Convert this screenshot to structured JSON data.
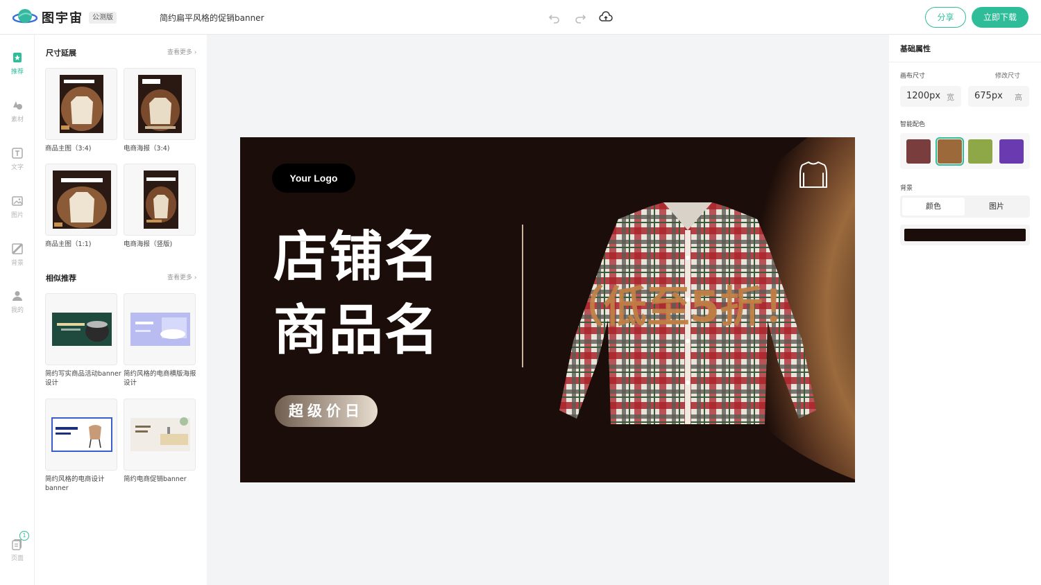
{
  "app": {
    "brand": "图宇宙",
    "badge": "公测版",
    "doc_title": "简约扁平风格的促销banner"
  },
  "toolbar": {
    "share_label": "分享",
    "download_label": "立即下载"
  },
  "rail": {
    "items": [
      {
        "label": "推荐",
        "icon": "star-icon"
      },
      {
        "label": "素材",
        "icon": "shapes-icon"
      },
      {
        "label": "文字",
        "icon": "text-icon"
      },
      {
        "label": "图片",
        "icon": "image-icon"
      },
      {
        "label": "背景",
        "icon": "background-icon"
      },
      {
        "label": "我的",
        "icon": "user-icon"
      }
    ],
    "pages": {
      "label": "页面",
      "count": "1"
    }
  },
  "panel": {
    "size_section": {
      "title": "尺寸延展",
      "more": "查看更多",
      "templates": [
        {
          "caption": "商品主图（3:4)"
        },
        {
          "caption": "电商海报（3:4)"
        },
        {
          "caption": "商品主图（1:1)"
        },
        {
          "caption": "电商海报（竖版)"
        }
      ]
    },
    "similar_section": {
      "title": "相似推荐",
      "more": "查看更多",
      "templates": [
        {
          "caption": "简约写实商品活动banner设计"
        },
        {
          "caption": "简约风格的电商横版海报设计"
        },
        {
          "caption": "简约风格的电商设计banner"
        },
        {
          "caption": "简约电商促销banner"
        }
      ]
    }
  },
  "banner": {
    "logo_text": "Your Logo",
    "shop_name": "店铺名",
    "product_name": "商品名",
    "pill_text": "超级价日",
    "discount_text": "（低至5折！",
    "colors": {
      "bg": "#1b0d09",
      "accent": "#c17f45"
    }
  },
  "props": {
    "title": "基础属性",
    "canvas_size_label": "画布尺寸",
    "resize_link": "修改尺寸",
    "width_value": "1200px",
    "width_unit": "宽",
    "height_value": "675px",
    "height_unit": "高",
    "palette_label": "智能配色",
    "palette": [
      "#7a3d3d",
      "#9c6a3a",
      "#8ea848",
      "#6a3bb0"
    ],
    "background_label": "背景",
    "bg_tabs": [
      "颜色",
      "图片"
    ],
    "bg_color": "#1b0d09"
  }
}
